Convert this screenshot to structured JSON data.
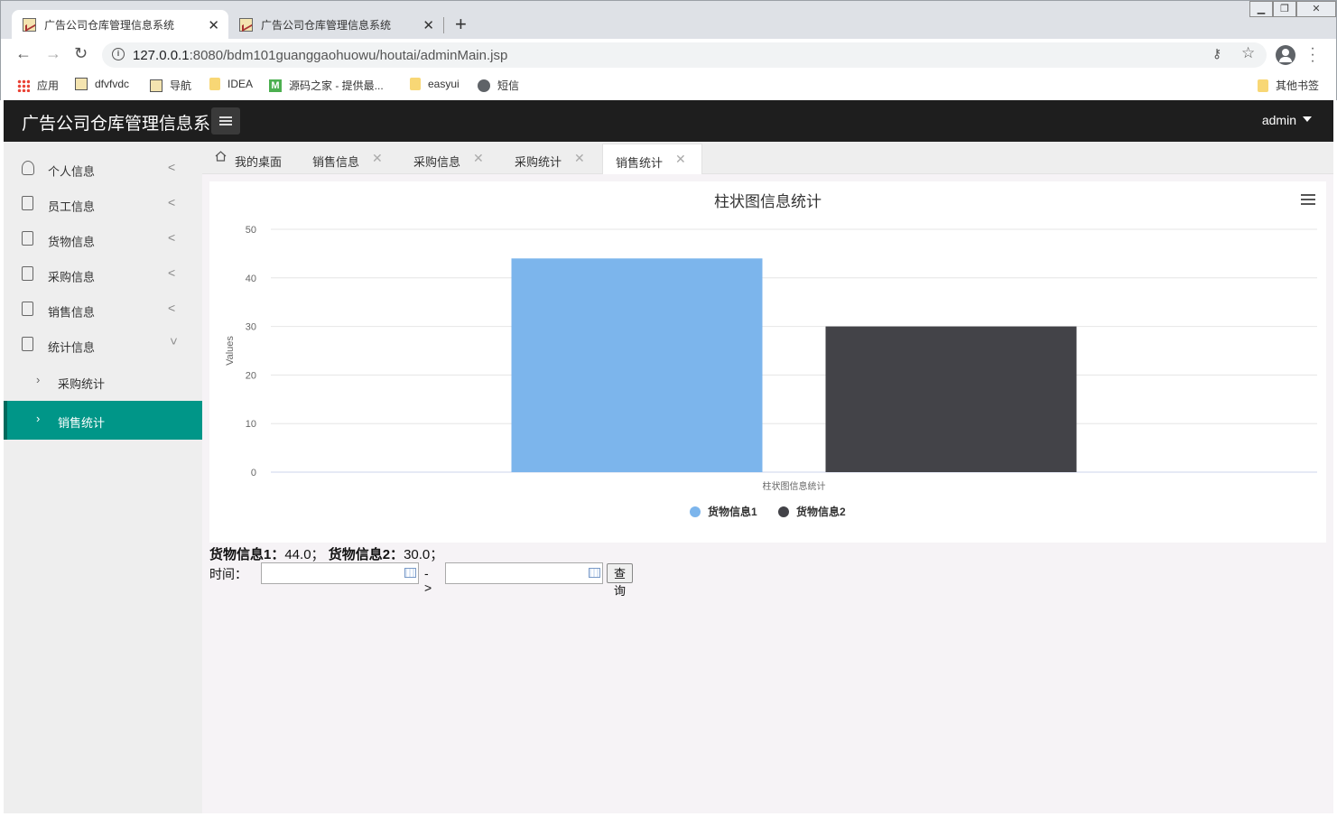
{
  "browser": {
    "tabs": [
      {
        "title": "广告公司仓库管理信息系统",
        "active": true
      },
      {
        "title": "广告公司仓库管理信息系统",
        "active": false
      }
    ],
    "url_host": "127.0.0.1",
    "url_rest": ":8080/bdm101guanggaohuowu/houtai/adminMain.jsp",
    "bookmarks": [
      "应用",
      "dfvfvdc",
      "导航",
      "IDEA",
      "源码之家 - 提供最...",
      "easyui",
      "短信"
    ],
    "other_bookmarks": "其他书签"
  },
  "header": {
    "title": "广告公司仓库管理信息系",
    "user": "admin"
  },
  "sidebar": {
    "items": [
      {
        "label": "个人信息",
        "icon": "user-icon",
        "expanded": false
      },
      {
        "label": "员工信息",
        "icon": "document-icon",
        "expanded": false
      },
      {
        "label": "货物信息",
        "icon": "document-icon",
        "expanded": false
      },
      {
        "label": "采购信息",
        "icon": "document-icon",
        "expanded": false
      },
      {
        "label": "销售信息",
        "icon": "document-icon",
        "expanded": false
      },
      {
        "label": "统计信息",
        "icon": "document-icon",
        "expanded": true
      }
    ],
    "subitems": [
      {
        "label": "采购统计",
        "active": false
      },
      {
        "label": "销售统计",
        "active": true
      }
    ],
    "active_color": "#009688"
  },
  "content_tabs": [
    {
      "label": "我的桌面",
      "closable": false
    },
    {
      "label": "销售信息",
      "closable": true
    },
    {
      "label": "采购信息",
      "closable": true
    },
    {
      "label": "采购统计",
      "closable": true
    },
    {
      "label": "销售统计",
      "closable": true,
      "active": true
    }
  ],
  "chart_data": {
    "type": "bar",
    "title": "柱状图信息统计",
    "categories": [
      "柱状图信息统计"
    ],
    "series": [
      {
        "name": "货物信息1",
        "values": [
          44.0
        ],
        "color": "#7cb5ec"
      },
      {
        "name": "货物信息2",
        "values": [
          30.0
        ],
        "color": "#434348"
      }
    ],
    "ylabel": "Values",
    "xlabel": "",
    "ylim": [
      0,
      50
    ],
    "yticks": [
      0,
      10,
      20,
      30,
      40,
      50
    ],
    "grid": true,
    "legend": "bottom-center"
  },
  "summary": {
    "label1": "货物信息1：",
    "value1": "44.0；",
    "label2": "货物信息2：",
    "value2": "30.0；"
  },
  "filter": {
    "label": "时间：",
    "start": "",
    "end": "",
    "separator": "->",
    "query_button": "查询"
  }
}
